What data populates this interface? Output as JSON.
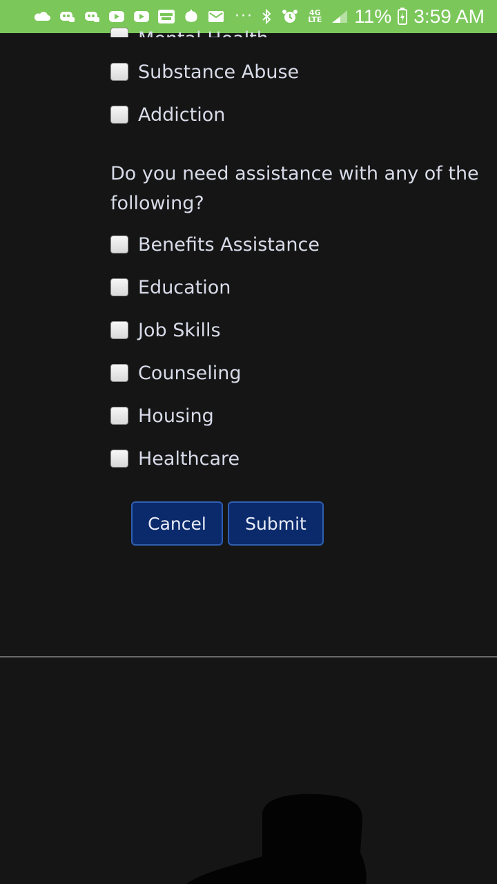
{
  "status_bar": {
    "icons": [
      "cloud-icon",
      "discord-icon",
      "discord-icon",
      "youtube-icon",
      "youtube-icon",
      "webtoon-icon",
      "animal-crossing-icon",
      "mail-icon"
    ],
    "more": "···",
    "battery_percent": "11%",
    "network": "4G LTE",
    "time": "3:59 AM"
  },
  "form": {
    "partial_item": "Mental Health",
    "group1": [
      "Substance Abuse",
      "Addiction"
    ],
    "question": "Do you need assistance with any of the following?",
    "group2": [
      "Benefits Assistance",
      "Education",
      "Job Skills",
      "Counseling",
      "Housing",
      "Healthcare"
    ],
    "buttons": {
      "cancel": "Cancel",
      "submit": "Submit"
    }
  },
  "colors": {
    "status_bar": "#7bc75a",
    "background": "#151515",
    "button_bg": "#0b2a6c",
    "button_border": "#2f5fb0"
  }
}
